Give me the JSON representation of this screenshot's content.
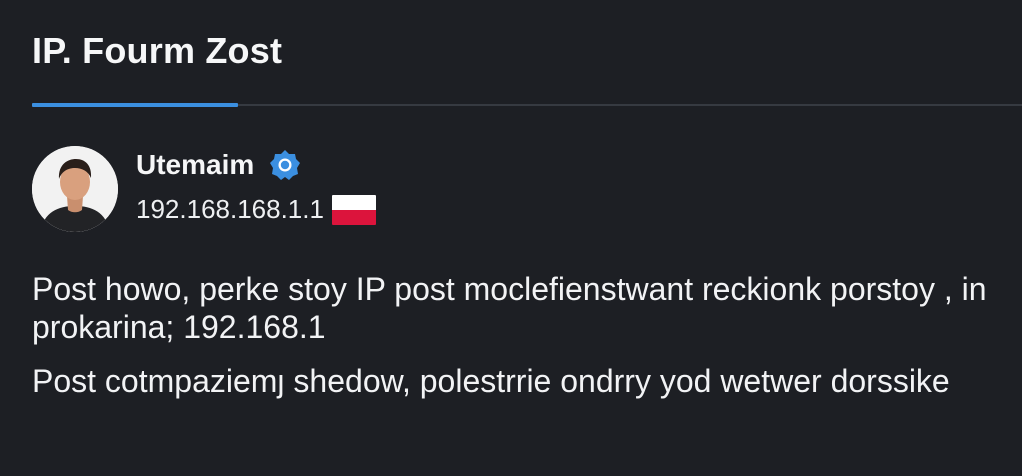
{
  "header": {
    "title": "IP. Fourm Zost"
  },
  "colors": {
    "background": "#1d1f24",
    "accent": "#3b8fe0",
    "divider": "#363a41",
    "flag_white": "#ffffff",
    "flag_red": "#dc143c"
  },
  "post": {
    "author": {
      "username": "Utemaim",
      "verified_icon": "verified-badge-icon",
      "ip": "192.168.168.1.1",
      "flag_icon": "poland-flag-icon"
    },
    "paragraphs": [
      "Post howo, perke stoy IP post moclefienstwant reckionk porstoy , in prokarina; 192.168.1",
      "Post cotmpaziemȷ shedow, polestrrie ondrry yod wetwer dorssike"
    ]
  }
}
